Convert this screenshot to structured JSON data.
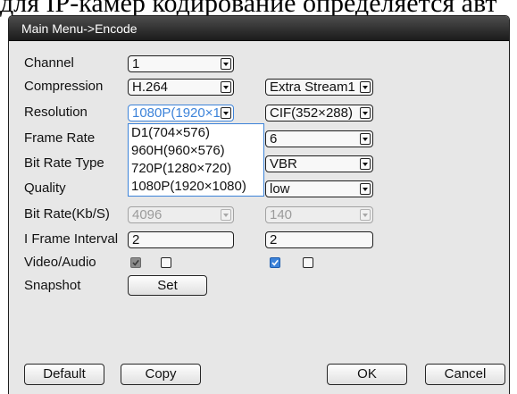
{
  "caption": {
    "text": "для IP-камер кодирование определяется авт"
  },
  "window": {
    "title": "Main Menu->Encode",
    "form": {
      "channel": {
        "label": "Channel",
        "main": {
          "value": "1"
        }
      },
      "compression": {
        "label": "Compression",
        "main": {
          "value": "H.264"
        },
        "extra": {
          "value": "Extra Stream1"
        }
      },
      "resolution": {
        "label": "Resolution",
        "main": {
          "value": "1080P(1920×1",
          "focused": true,
          "open": true
        },
        "extra": {
          "value": "CIF(352×288)"
        }
      },
      "frame_rate": {
        "label": "Frame Rate",
        "extra": {
          "value": "6"
        }
      },
      "bit_rate_type": {
        "label": "Bit Rate Type",
        "extra": {
          "value": "VBR"
        }
      },
      "quality": {
        "label": "Quality",
        "extra": {
          "value": "low"
        }
      },
      "bit_rate": {
        "label": "Bit Rate(Kb/S)",
        "main": {
          "value": "4096",
          "disabled": true
        },
        "extra": {
          "value": "140",
          "disabled": true
        }
      },
      "i_frame_interval": {
        "label": "I Frame Interval",
        "main": {
          "value": "2"
        },
        "extra": {
          "value": "2"
        }
      },
      "video_audio": {
        "label": "Video/Audio",
        "main": {
          "video": {
            "checked": true,
            "disabled": true
          },
          "audio": {
            "checked": false
          }
        },
        "extra": {
          "video": {
            "checked": true
          },
          "audio": {
            "checked": false
          }
        }
      },
      "snapshot": {
        "label": "Snapshot",
        "button_label": "Set"
      }
    },
    "resolution_dropdown": {
      "options": [
        "D1(704×576)",
        "960H(960×576)",
        "720P(1280×720)",
        "1080P(1920×1080)"
      ]
    },
    "footer": {
      "default_label": "Default",
      "copy_label": "Copy",
      "ok_label": "OK",
      "cancel_label": "Cancel"
    }
  },
  "icons": {
    "dropdown_arrow": "chevron-down-icon",
    "checkbox_tick": "check-icon"
  },
  "colors": {
    "accent": "#3d83d9",
    "panel": "#e7e7e7",
    "titlebar_top": "#4d4d4d",
    "titlebar_bottom": "#1b1b1b"
  }
}
